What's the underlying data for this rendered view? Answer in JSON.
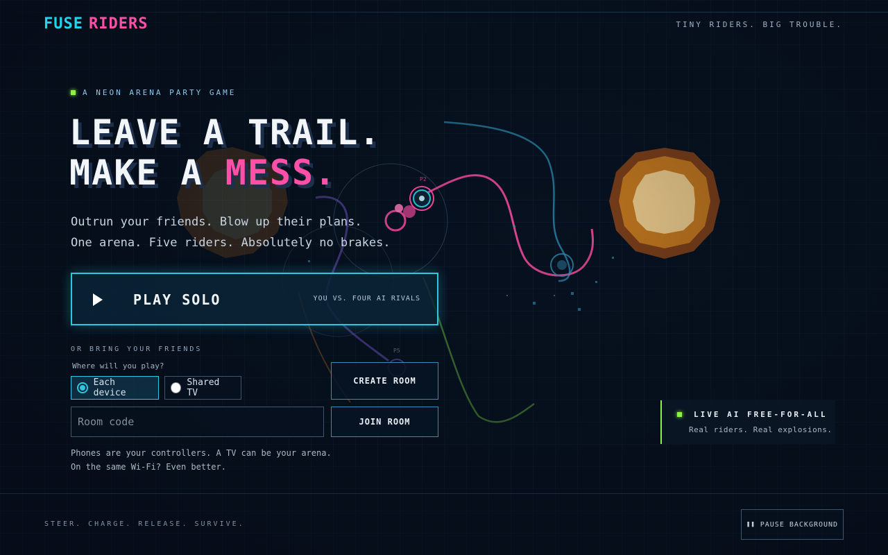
{
  "header": {
    "logo_part1": "FUSE",
    "logo_part2": "RIDERS",
    "tagline": "TINY RIDERS. BIG TROUBLE."
  },
  "hero": {
    "kicker": "A NEON ARENA PARTY GAME",
    "headline_line1": "LEAVE A TRAIL.",
    "headline_line2_prefix": "MAKE A ",
    "headline_line2_accent": "MESS.",
    "sub_line1": "Outrun your friends. Blow up their plans.",
    "sub_line2": "One arena. Five riders. Absolutely no brakes."
  },
  "play": {
    "label": "PLAY SOLO",
    "note": "YOU VS. FOUR AI RIVALS",
    "icon": "play-icon"
  },
  "multiplayer": {
    "heading": "OR BRING YOUR FRIENDS",
    "question": "Where will you play?",
    "options": [
      {
        "label": "Each device",
        "selected": true
      },
      {
        "label": "Shared TV",
        "selected": false
      }
    ],
    "create_label": "CREATE ROOM",
    "join_label": "JOIN ROOM",
    "room_code_placeholder": "Room code",
    "room_code_value": "",
    "help_line1": "Phones are your controllers. A TV can be your arena.",
    "help_line2": "On the same Wi-Fi? Even better."
  },
  "live_panel": {
    "title": "LIVE AI FREE-FOR-ALL",
    "subtitle": "Real riders. Real explosions."
  },
  "footer": {
    "slogan": "STEER. CHARGE. RELEASE. SURVIVE.",
    "pause_label": "PAUSE BACKGROUND",
    "pause_icon": "pause-icon"
  },
  "arena": {
    "rider_labels": [
      "P2",
      "P5"
    ],
    "colors": {
      "cyan": "#1fd5f0",
      "pink": "#ff4fa6",
      "green": "#8cf24a",
      "purple": "#7b5cd6",
      "orange": "#f08a1f",
      "blue_trail": "#2f8fb5"
    }
  }
}
